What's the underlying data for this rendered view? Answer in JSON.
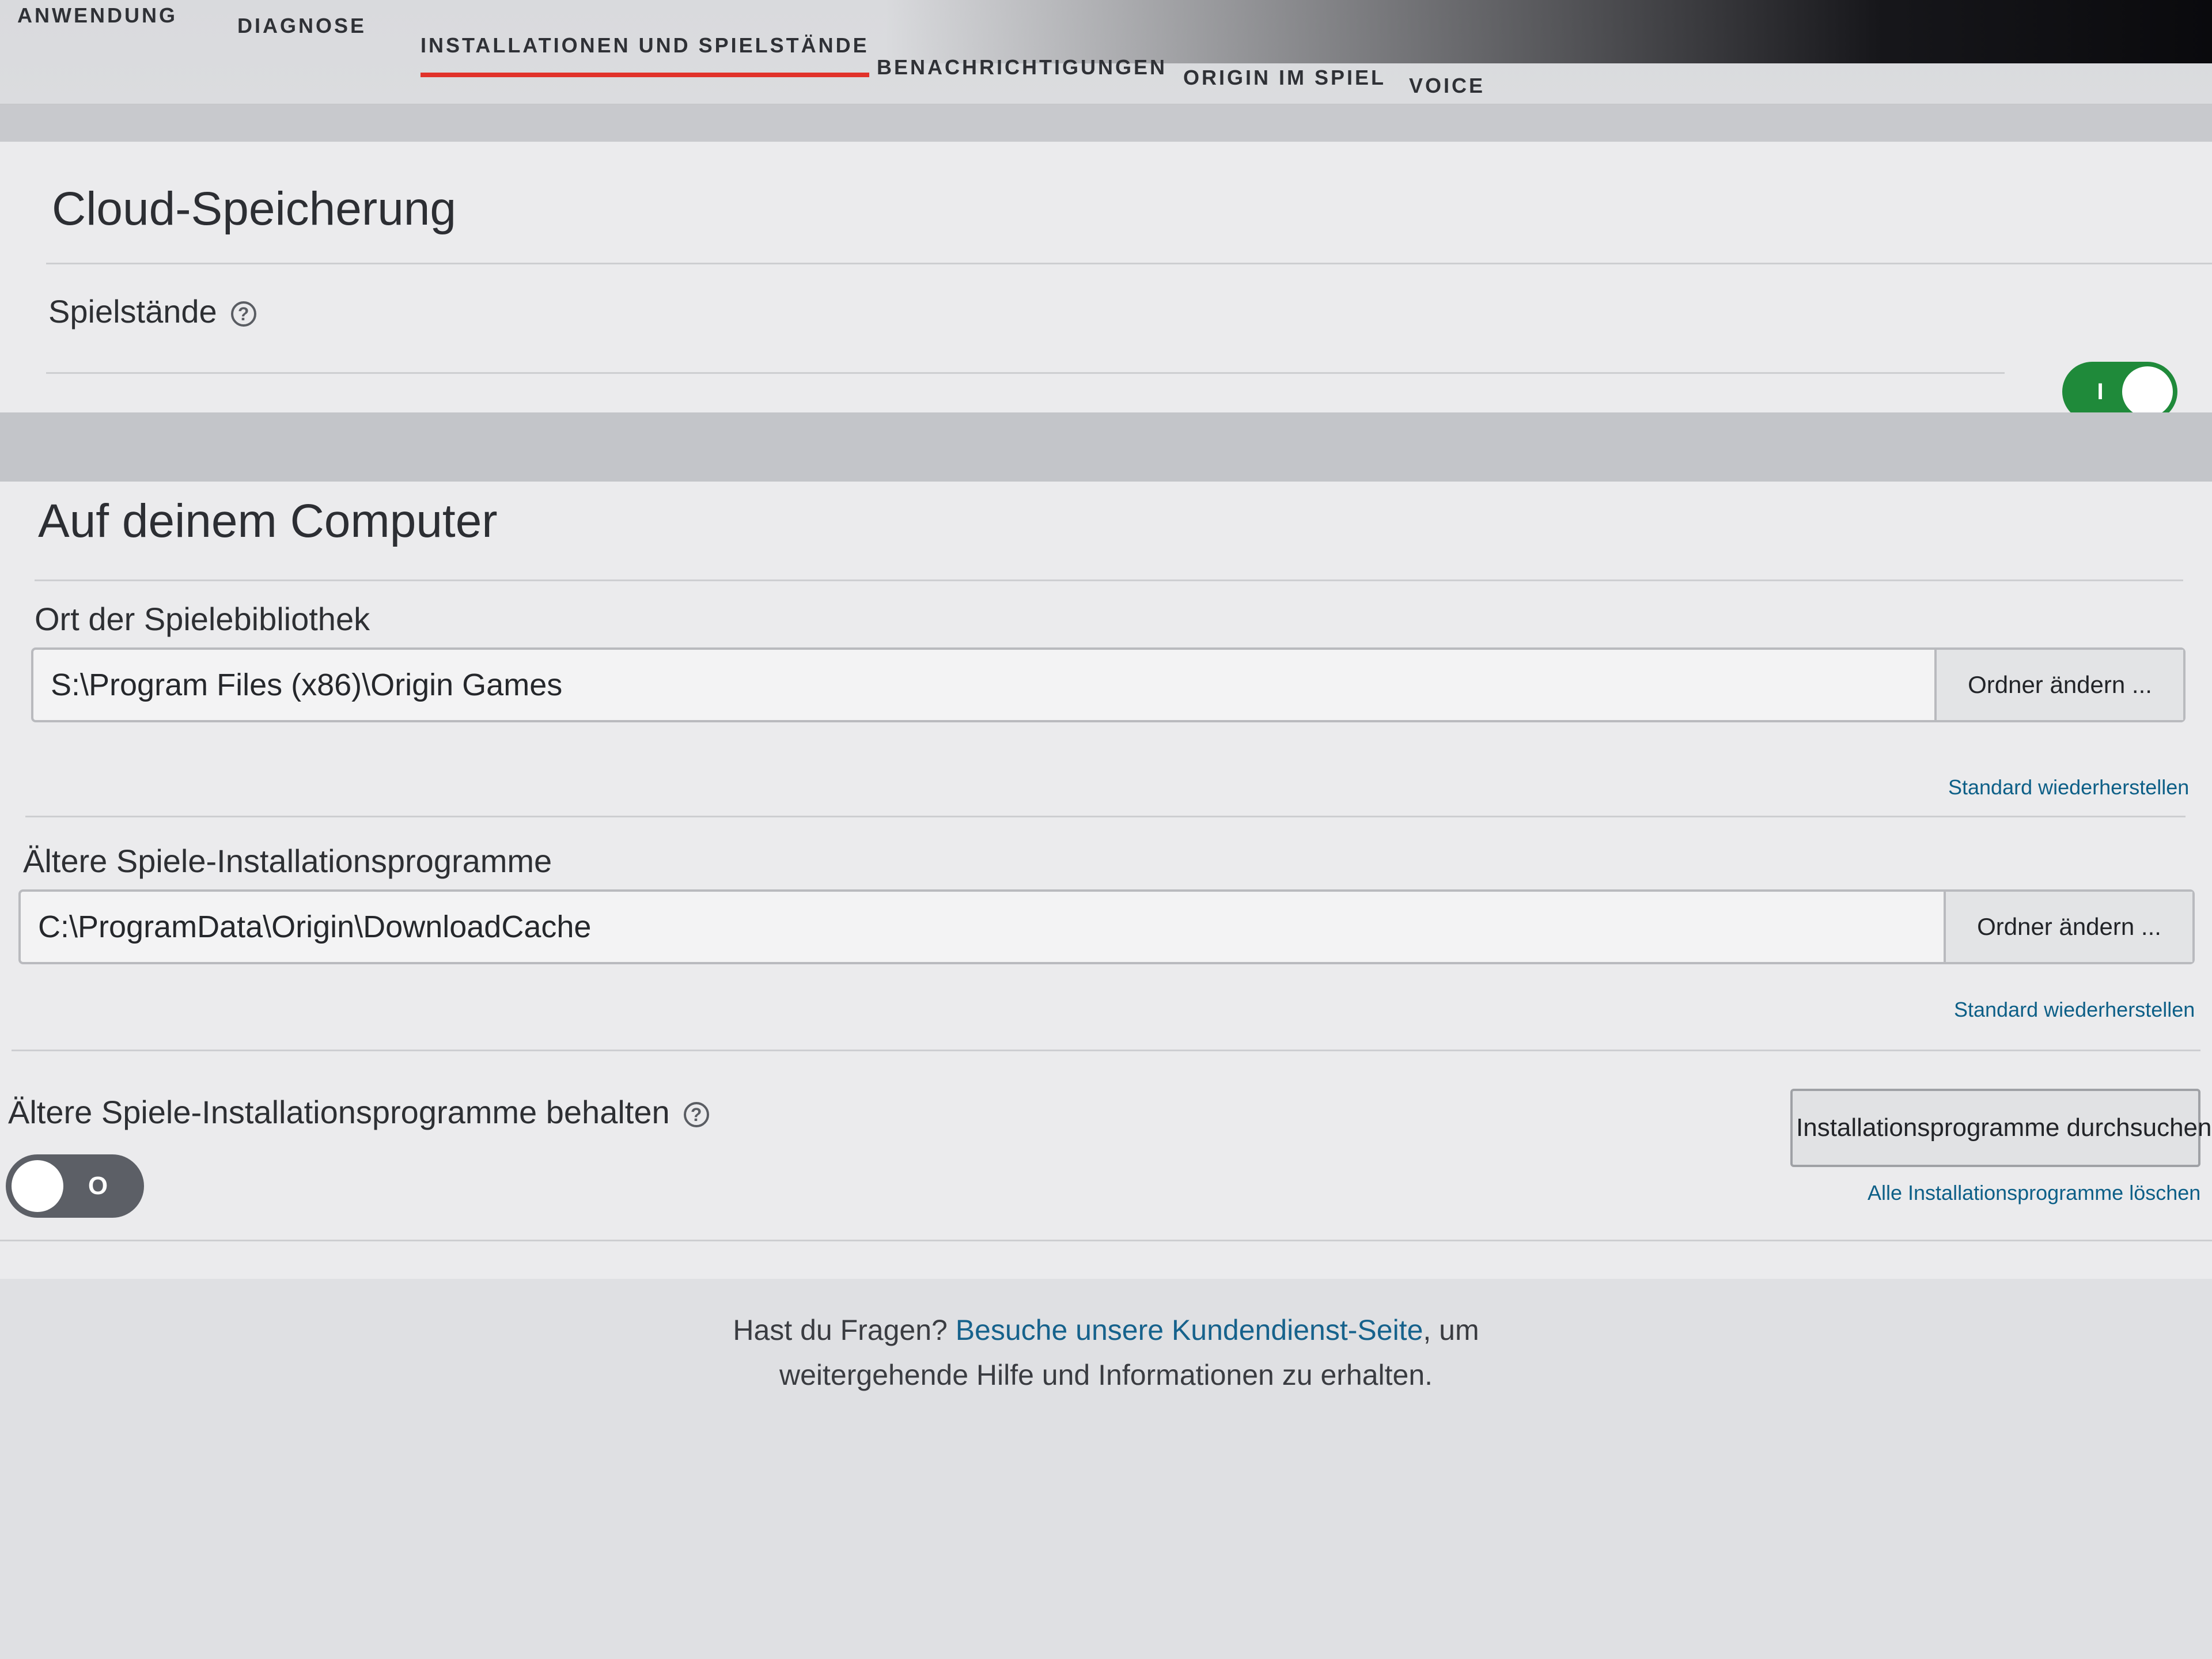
{
  "tabs": [
    {
      "label": "ANWENDUNG"
    },
    {
      "label": "DIAGNOSE"
    },
    {
      "label": "INSTALLATIONEN UND SPIELSTÄNDE",
      "active": true
    },
    {
      "label": "BENACHRICHTIGUNGEN"
    },
    {
      "label": "ORIGIN IM SPIEL"
    },
    {
      "label": "VOICE"
    }
  ],
  "cloud": {
    "title": "Cloud-Speicherung",
    "savegames_label": "Spielstände",
    "savegames_toggle": {
      "state": "on",
      "mark": "I"
    }
  },
  "computer": {
    "title": "Auf deinem Computer",
    "library": {
      "label": "Ort der Spielebibliothek",
      "path": "S:\\Program Files (x86)\\Origin Games",
      "change_button": "Ordner ändern ...",
      "restore_link": "Standard wiederherstellen"
    },
    "legacy": {
      "label": "Ältere Spiele-Installationsprogramme",
      "path": "C:\\ProgramData\\Origin\\DownloadCache",
      "change_button": "Ordner ändern ...",
      "restore_link": "Standard wiederherstellen"
    },
    "keep": {
      "label": "Ältere Spiele-Installationsprogramme behalten",
      "toggle": {
        "state": "off",
        "mark": "O"
      },
      "browse_button": "Installationsprogramme durchsuchen",
      "delete_link": "Alle Installationsprogramme löschen"
    }
  },
  "footer": {
    "text_before": "Hast du Fragen? ",
    "link": "Besuche unsere Kundendienst-Seite",
    "text_after": ", um",
    "line2": "weitergehende Hilfe und Informationen zu erhalten."
  },
  "colors": {
    "accent_red": "#e1322a",
    "toggle_on": "#1f8a3a",
    "toggle_off": "#5c5f66",
    "link_blue": "#0d5f87"
  }
}
